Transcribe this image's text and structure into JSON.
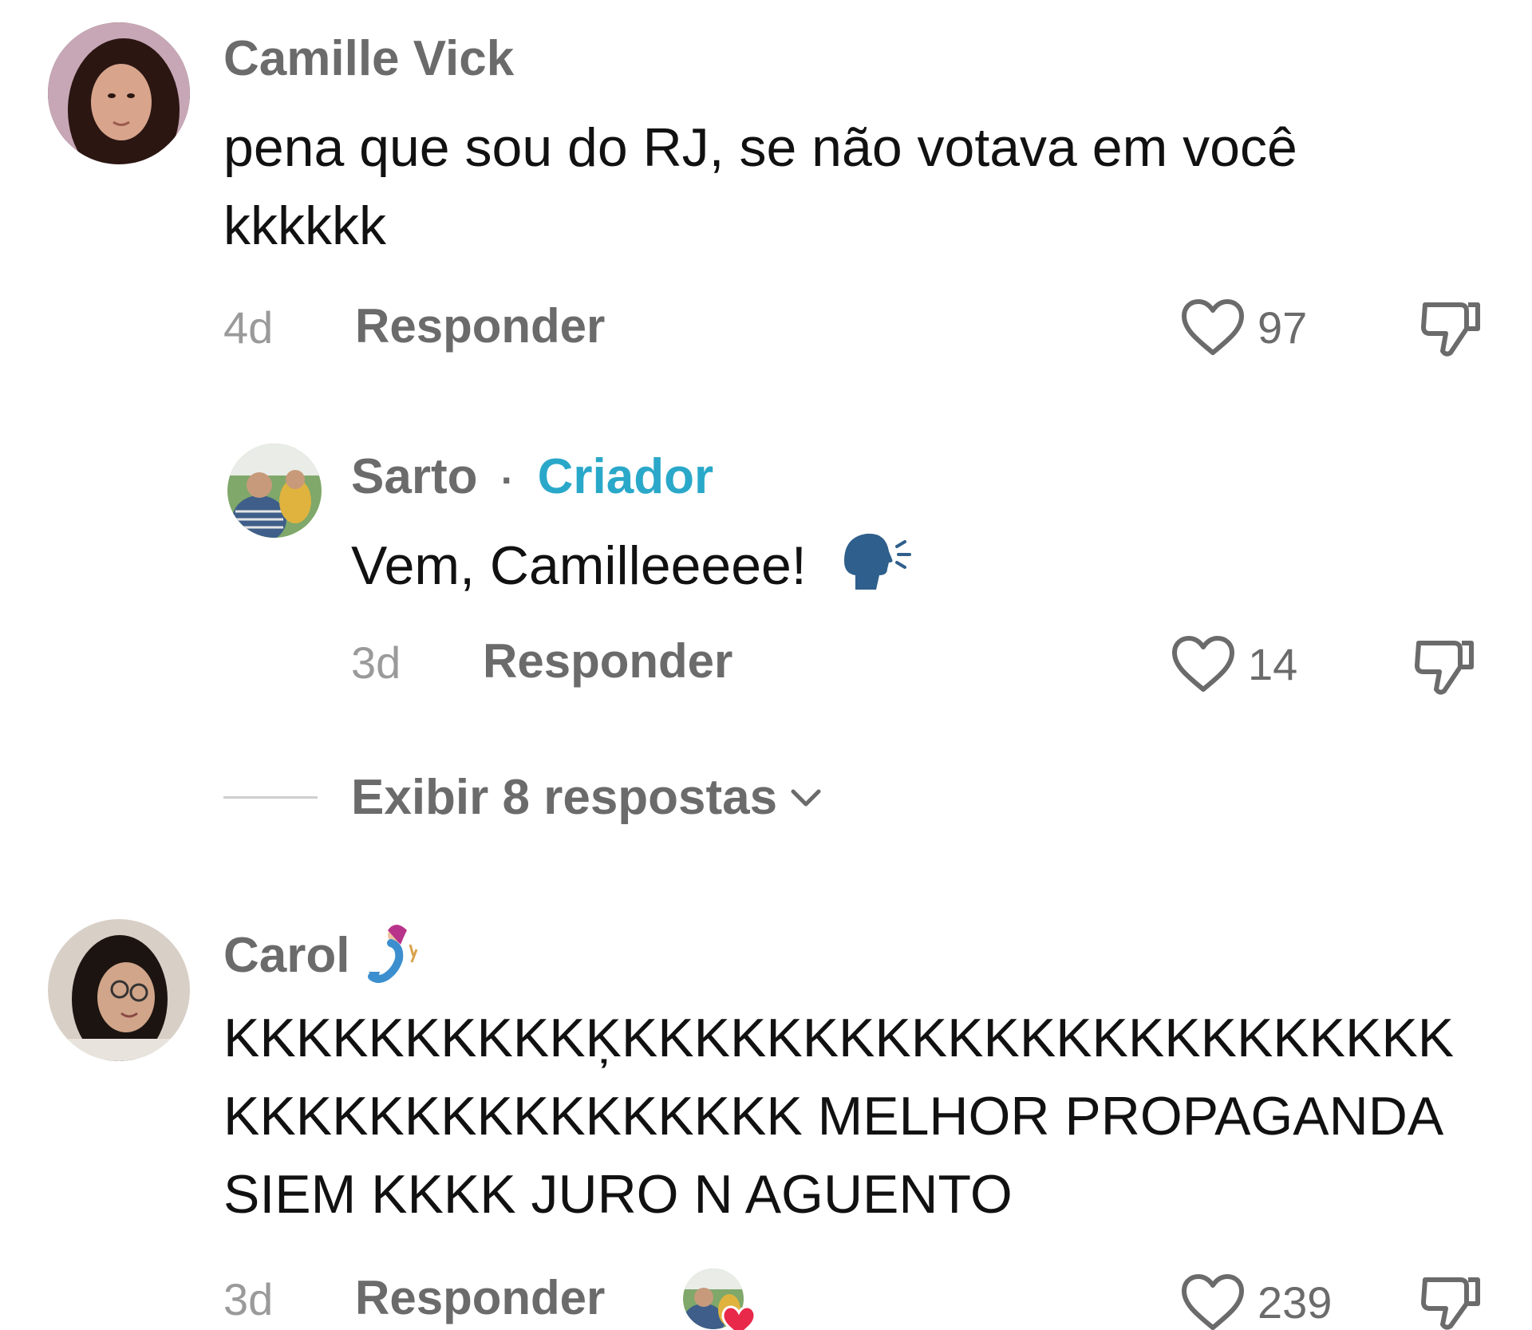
{
  "comments": [
    {
      "username": "Camille Vick",
      "text": "pena que sou do RJ, se não votava em você kkkkkk",
      "time": "4d",
      "reply_label": "Responder",
      "likes": "97"
    },
    {
      "username": "Sarto",
      "separator": "·",
      "creator_label": "Criador",
      "text": "Vem, Camilleeeee!",
      "emoji": "🗣️",
      "time": "3d",
      "reply_label": "Responder",
      "likes": "14"
    },
    {
      "username": "Carol",
      "username_emoji": "🧜‍♀️",
      "text": "KKKKKKKKKKĶKKKKKKKKKKKKKKKKKKKKKKKKKKKKKKKKKKKKKKK MELHOR PROPAGANDA SIEM KKKK JURO N AGUENTO",
      "time": "3d",
      "reply_label": "Responder",
      "likes": "239"
    }
  ],
  "view_replies": {
    "label": "Exibir 8 respostas"
  },
  "colors": {
    "accent_creator": "#2aa8c9",
    "liked_heart": "#e8294a"
  }
}
